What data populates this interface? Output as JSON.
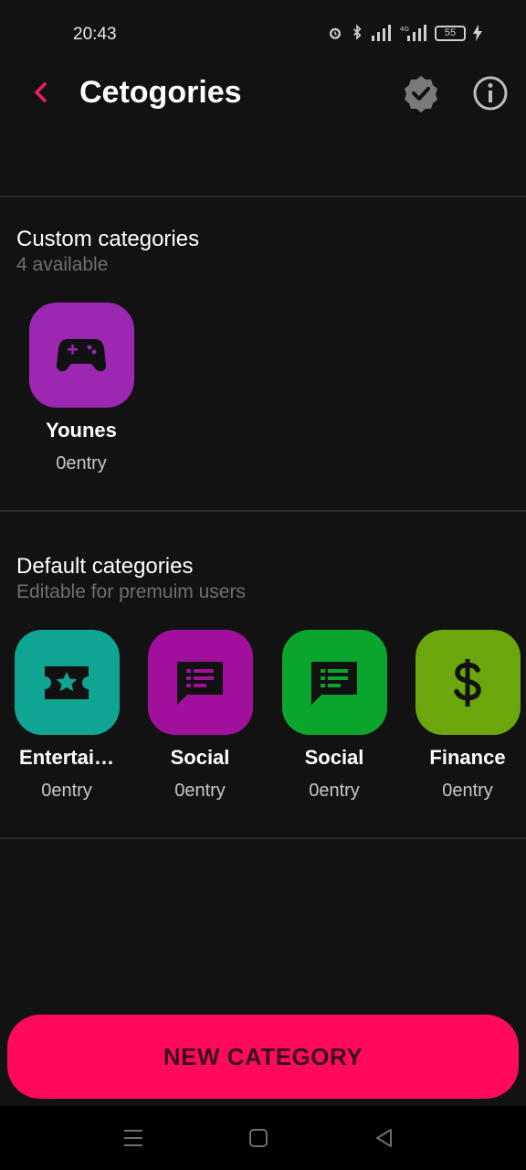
{
  "status_bar": {
    "time": "20:43",
    "battery": "55"
  },
  "app_bar": {
    "title": "Cetogories",
    "accent_color": "#e91e63"
  },
  "custom_section": {
    "title": "Custom categories",
    "subtitle": "4 available",
    "items": [
      {
        "name": "Younes",
        "count": "0entry",
        "icon": "gamepad-icon",
        "color": "#9c27b0"
      }
    ]
  },
  "default_section": {
    "title": "Default categories",
    "subtitle": "Editable for premuim users",
    "items": [
      {
        "name": "Entertai…",
        "count": "0entry",
        "icon": "ticket-star-icon",
        "color": "#0fa592"
      },
      {
        "name": "Social",
        "count": "0entry",
        "icon": "chat-icon",
        "color": "#a0109c"
      },
      {
        "name": "Social",
        "count": "0entry",
        "icon": "chat-icon",
        "color": "#0aa52c"
      },
      {
        "name": "Finance",
        "count": "0entry",
        "icon": "dollar-icon",
        "color": "#6aa60c"
      }
    ]
  },
  "new_button": {
    "label": "NEW CATEGORY",
    "color": "#ff0a5c"
  },
  "nav_bar": {
    "items": [
      "menu-icon",
      "home-square-icon",
      "back-triangle-icon"
    ]
  }
}
